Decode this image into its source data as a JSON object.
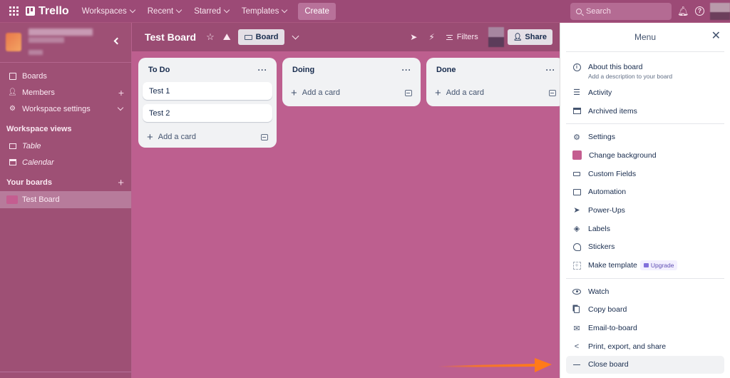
{
  "topnav": {
    "app_name": "Trello",
    "menus": [
      "Workspaces",
      "Recent",
      "Starred",
      "Templates"
    ],
    "create_label": "Create",
    "search_placeholder": "Search"
  },
  "sidebar": {
    "nav": [
      {
        "label": "Boards",
        "icon": "board-icon"
      },
      {
        "label": "Members",
        "icon": "person-icon"
      },
      {
        "label": "Workspace settings",
        "icon": "gear-icon"
      }
    ],
    "views_title": "Workspace views",
    "views": [
      {
        "label": "Table",
        "icon": "table-icon"
      },
      {
        "label": "Calendar",
        "icon": "calendar-icon"
      }
    ],
    "boards_title": "Your boards",
    "boards": [
      {
        "label": "Test Board",
        "color": "#c45d90"
      }
    ]
  },
  "board": {
    "title": "Test Board",
    "view_label": "Board",
    "filters_label": "Filters",
    "share_label": "Share",
    "background_color": "#bd5f8f"
  },
  "lists": [
    {
      "title": "To Do",
      "cards": [
        "Test 1",
        "Test 2"
      ],
      "add_label": "Add a card"
    },
    {
      "title": "Doing",
      "cards": [],
      "add_label": "Add a card"
    },
    {
      "title": "Done",
      "cards": [],
      "add_label": "Add a card"
    }
  ],
  "menu": {
    "title": "Menu",
    "about": {
      "label": "About this board",
      "sub": "Add a description to your board"
    },
    "group1": [
      "Activity",
      "Archived items"
    ],
    "group2": [
      "Settings",
      "Change background",
      "Custom Fields",
      "Automation",
      "Power-Ups",
      "Labels",
      "Stickers",
      "Make template"
    ],
    "upgrade_label": "Upgrade",
    "group3": [
      "Watch",
      "Copy board",
      "Email-to-board",
      "Print, export, and share",
      "Close board"
    ]
  }
}
